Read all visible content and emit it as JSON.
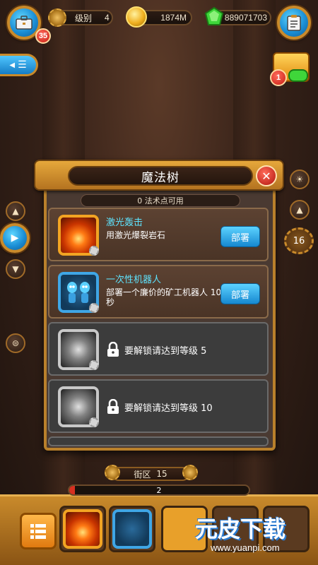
{
  "top_bar": {
    "briefcase_badge": "35",
    "level_label": "级别",
    "level_value": "4",
    "gold_value": "1874M",
    "gems_value": "889071703"
  },
  "side": {
    "treasure_badge": "1",
    "right_level": "16"
  },
  "dialog": {
    "title": "魔法树",
    "points_text": "0 法术点可用",
    "skills": [
      {
        "name": "激光轰击",
        "desc": "用激光爆裂岩石",
        "action": "部署"
      },
      {
        "name": "一次性机器人",
        "desc": "部署一个廉价的矿工机器人 10秒",
        "action": "部署"
      }
    ],
    "locked": [
      {
        "text": "要解锁请达到等级  5"
      },
      {
        "text": "要解锁请达到等级  10"
      }
    ]
  },
  "bottom": {
    "district_label": "街区",
    "district_value": "15",
    "progress_value": "2",
    "progress_fraction": 0.03
  },
  "watermark": {
    "brand": "元皮下载",
    "url": "www.yuanpi.com"
  }
}
